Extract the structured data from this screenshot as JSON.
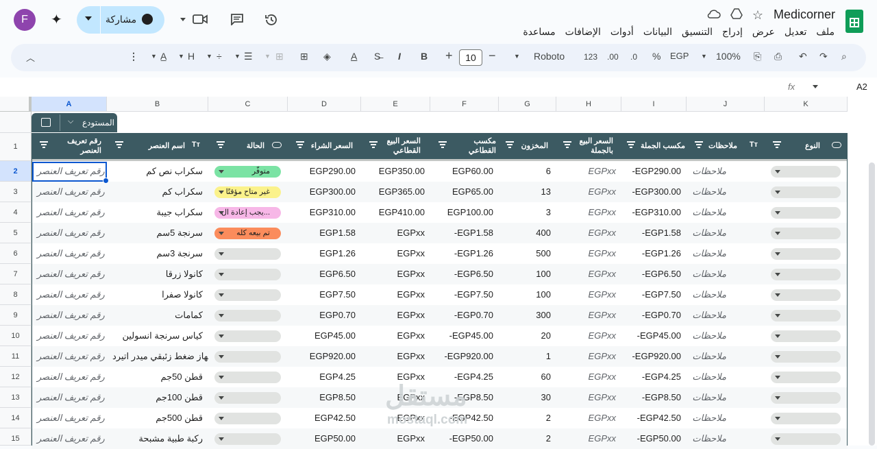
{
  "doc": {
    "title": "Medicorner",
    "menus": [
      "ملف",
      "تعديل",
      "عرض",
      "إدراج",
      "التنسيق",
      "البيانات",
      "أدوات",
      "الإضافات",
      "مساعدة"
    ]
  },
  "user": {
    "initial": "F",
    "avatar_color": "#8e44ad"
  },
  "share": {
    "label": "مشاركة"
  },
  "toolbar": {
    "zoom": "100%",
    "currency": "EGP",
    "percent": "%",
    "dec_dec": ".0",
    "dec_inc": ".00",
    "format_123": "123",
    "font": "Roboto",
    "font_size": "10",
    "bold": "B",
    "italic": "I",
    "text_color_glyph": "A"
  },
  "formula_bar": {
    "cell_ref": "A2",
    "fx": "fx"
  },
  "columns": [
    "A",
    "B",
    "C",
    "D",
    "E",
    "F",
    "G",
    "H",
    "I",
    "J",
    "K"
  ],
  "table": {
    "name": "المستودع",
    "headers": {
      "A": "رقم تعريف العنصر",
      "B": "اسم العنصر",
      "C": "الحالة",
      "D": "السعر الشراء",
      "E": "السعر البيع القطاعي",
      "F": "مكسب القطاعي",
      "G": "المخزون",
      "H": "السعر البيع بالجملة",
      "I": "مكسب الجملة",
      "J": "ملاحظات",
      "K": "النوع"
    },
    "rows": [
      {
        "n": "2",
        "a": "رقم تعريف العنصر",
        "b": "سكراب نص كم",
        "c": "متوفّر",
        "c_color": "#7be3a4",
        "d": "EGP290.00",
        "e": "EGP350.00",
        "f": "EGP60.00",
        "g": "6",
        "h": "EGPxx",
        "i": "-EGP290.00",
        "j": "ملاحظات"
      },
      {
        "n": "3",
        "a": "رقم تعريف العنصر",
        "b": "سكراب كم",
        "c": "غير متاح مؤقتًا",
        "c_color": "#fbf28b",
        "d": "EGP300.00",
        "e": "EGP365.00",
        "f": "EGP65.00",
        "g": "13",
        "h": "EGPxx",
        "i": "-EGP300.00",
        "j": "ملاحظات"
      },
      {
        "n": "4",
        "a": "رقم تعريف العنصر",
        "b": "سكراب جيبة",
        "c": "يجب إعادة ال...",
        "c_color": "#f7b7e7",
        "d": "EGP310.00",
        "e": "EGP410.00",
        "f": "EGP100.00",
        "g": "3",
        "h": "EGPxx",
        "i": "-EGP310.00",
        "j": "ملاحظات"
      },
      {
        "n": "5",
        "a": "رقم تعريف العنصر",
        "b": "سرنجة 5سم",
        "c": "تم بيعه كله",
        "c_color": "#fb8c5c",
        "d": "EGP1.58",
        "e": "EGPxx",
        "f": "-EGP1.58",
        "g": "400",
        "h": "EGPxx",
        "i": "-EGP1.58",
        "j": "ملاحظات"
      },
      {
        "n": "6",
        "a": "رقم تعريف العنصر",
        "b": "سرنجة 3سم",
        "c": "",
        "c_color": "",
        "d": "EGP1.26",
        "e": "EGPxx",
        "f": "-EGP1.26",
        "g": "500",
        "h": "EGPxx",
        "i": "-EGP1.26",
        "j": "ملاحظات"
      },
      {
        "n": "7",
        "a": "رقم تعريف العنصر",
        "b": "كانولا زرقا",
        "c": "",
        "c_color": "",
        "d": "EGP6.50",
        "e": "EGPxx",
        "f": "-EGP6.50",
        "g": "100",
        "h": "EGPxx",
        "i": "-EGP6.50",
        "j": "ملاحظات"
      },
      {
        "n": "8",
        "a": "رقم تعريف العنصر",
        "b": "كانولا صفرا",
        "c": "",
        "c_color": "",
        "d": "EGP7.50",
        "e": "EGPxx",
        "f": "-EGP7.50",
        "g": "100",
        "h": "EGPxx",
        "i": "-EGP7.50",
        "j": "ملاحظات"
      },
      {
        "n": "9",
        "a": "رقم تعريف العنصر",
        "b": "كمامات",
        "c": "",
        "c_color": "",
        "d": "EGP0.70",
        "e": "EGPxx",
        "f": "-EGP0.70",
        "g": "300",
        "h": "EGPxx",
        "i": "-EGP0.70",
        "j": "ملاحظات"
      },
      {
        "n": "10",
        "a": "رقم تعريف العنصر",
        "b": "كياس سرنجة انسولين",
        "c": "",
        "c_color": "",
        "d": "EGP45.00",
        "e": "EGPxx",
        "f": "-EGP45.00",
        "g": "20",
        "h": "EGPxx",
        "i": "-EGP45.00",
        "j": "ملاحظات"
      },
      {
        "n": "11",
        "a": "رقم تعريف العنصر",
        "b": "جهاز ضغط زئبقي ميدر اتيرد",
        "c": "",
        "c_color": "",
        "d": "EGP920.00",
        "e": "EGPxx",
        "f": "-EGP920.00",
        "g": "1",
        "h": "EGPxx",
        "i": "-EGP920.00",
        "j": "ملاحظات"
      },
      {
        "n": "12",
        "a": "رقم تعريف العنصر",
        "b": "قطن 50جم",
        "c": "",
        "c_color": "",
        "d": "EGP4.25",
        "e": "EGPxx",
        "f": "-EGP4.25",
        "g": "60",
        "h": "EGPxx",
        "i": "-EGP4.25",
        "j": "ملاحظات"
      },
      {
        "n": "13",
        "a": "رقم تعريف العنصر",
        "b": "قطن 100جم",
        "c": "",
        "c_color": "",
        "d": "EGP8.50",
        "e": "EGPxx",
        "f": "-EGP8.50",
        "g": "30",
        "h": "EGPxx",
        "i": "-EGP8.50",
        "j": "ملاحظات"
      },
      {
        "n": "14",
        "a": "رقم تعريف العنصر",
        "b": "قطن 500جم",
        "c": "",
        "c_color": "",
        "d": "EGP42.50",
        "e": "EGPxx",
        "f": "-EGP42.50",
        "g": "2",
        "h": "EGPxx",
        "i": "-EGP42.50",
        "j": "ملاحظات"
      },
      {
        "n": "15",
        "a": "رقم تعريف العنصر",
        "b": "ركبة طبية مشبحة",
        "c": "",
        "c_color": "",
        "d": "EGP50.00",
        "e": "EGPxx",
        "f": "-EGP50.00",
        "g": "2",
        "h": "EGPxx",
        "i": "-EGP50.00",
        "j": "ملاحظات"
      }
    ]
  },
  "watermark": {
    "arabic": "مستقل",
    "latin": "mostaql.com"
  },
  "colors": {
    "header_bg": "#3c5a62",
    "selection": "#0b57d0",
    "share_bg": "#c2e7ff"
  }
}
